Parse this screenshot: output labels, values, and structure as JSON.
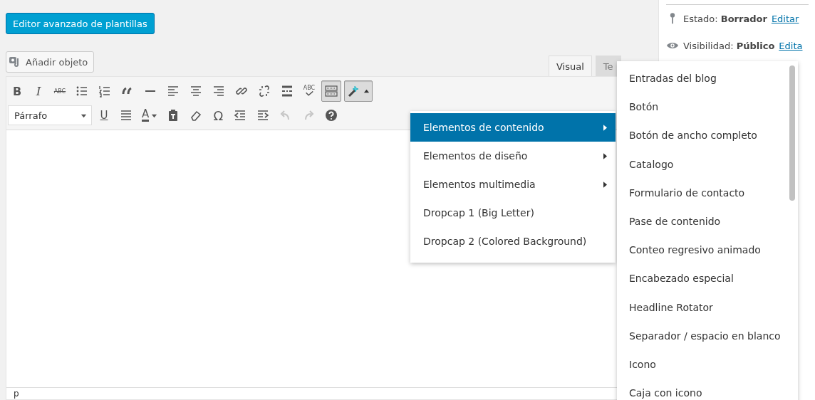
{
  "template_editor_button": "Editor avanzado de plantillas",
  "add_media_button": "Añadir objeto",
  "editor_tabs": [
    {
      "label": "Visual",
      "selected": true
    },
    {
      "label": "Te",
      "selected": false
    }
  ],
  "toolbar_rows": [
    [
      {
        "kind": "bold",
        "text": "B",
        "pressed": false,
        "disabled": false
      },
      {
        "kind": "italic",
        "text": "I",
        "pressed": false,
        "disabled": false
      },
      {
        "kind": "strike",
        "text": "ABC",
        "pressed": false,
        "disabled": false
      },
      {
        "kind": "bullets",
        "pressed": false,
        "disabled": false
      },
      {
        "kind": "numbers",
        "pressed": false,
        "disabled": false
      },
      {
        "kind": "quote",
        "pressed": false,
        "disabled": false
      },
      {
        "kind": "rule",
        "pressed": false,
        "disabled": false
      },
      {
        "kind": "alignleft",
        "pressed": false,
        "disabled": false
      },
      {
        "kind": "aligncenter",
        "pressed": false,
        "disabled": false
      },
      {
        "kind": "alignright",
        "pressed": false,
        "disabled": false
      },
      {
        "kind": "link",
        "pressed": false,
        "disabled": false
      },
      {
        "kind": "unlink",
        "pressed": false,
        "disabled": false
      },
      {
        "kind": "more",
        "pressed": false,
        "disabled": false
      },
      {
        "kind": "spell",
        "text": "ABC",
        "pressed": false,
        "disabled": false
      },
      {
        "kind": "keyboard",
        "pressed": true,
        "disabled": false
      },
      {
        "kind": "wand",
        "pressed": true,
        "disabled": false
      }
    ],
    [
      {
        "kind": "format",
        "text": "Párrafo"
      },
      {
        "kind": "underline",
        "text": "U",
        "pressed": false,
        "disabled": false
      },
      {
        "kind": "justify",
        "pressed": false,
        "disabled": false
      },
      {
        "kind": "color",
        "text": "A",
        "pressed": false,
        "disabled": false
      },
      {
        "kind": "paste",
        "pressed": false,
        "disabled": false
      },
      {
        "kind": "eraser",
        "pressed": false,
        "disabled": false
      },
      {
        "kind": "omega",
        "text": "Ω",
        "pressed": false,
        "disabled": false
      },
      {
        "kind": "outdent",
        "pressed": false,
        "disabled": false
      },
      {
        "kind": "indent",
        "pressed": false,
        "disabled": false
      },
      {
        "kind": "undo",
        "pressed": false,
        "disabled": true
      },
      {
        "kind": "redo",
        "pressed": false,
        "disabled": true
      },
      {
        "kind": "help",
        "pressed": false,
        "disabled": false
      }
    ]
  ],
  "status_path": "p",
  "shortcode_menu": [
    {
      "label": "Elementos de contenido",
      "has_submenu": true,
      "selected": true
    },
    {
      "label": "Elementos de diseño",
      "has_submenu": true,
      "selected": false
    },
    {
      "label": "Elementos multimedia",
      "has_submenu": true,
      "selected": false
    },
    {
      "label": "Dropcap 1 (Big Letter)",
      "has_submenu": false,
      "selected": false
    },
    {
      "label": "Dropcap 2 (Colored Background)",
      "has_submenu": false,
      "selected": false
    }
  ],
  "submenu": [
    "Entradas del blog",
    "Botón",
    "Botón de ancho completo",
    "Catalogo",
    "Formulario de contacto",
    "Pase de contenido",
    "Conteo regresivo animado",
    "Encabezado especial",
    "Headline Rotator",
    "Separador / espacio en blanco",
    "Icono",
    "Caja con icono"
  ],
  "publish_box": [
    {
      "kind": "status",
      "label": "Estado:",
      "value": "Borrador",
      "link": "Editar"
    },
    {
      "kind": "visibility",
      "label": "Visibilidad:",
      "value": "Público",
      "link": "Edita"
    }
  ]
}
